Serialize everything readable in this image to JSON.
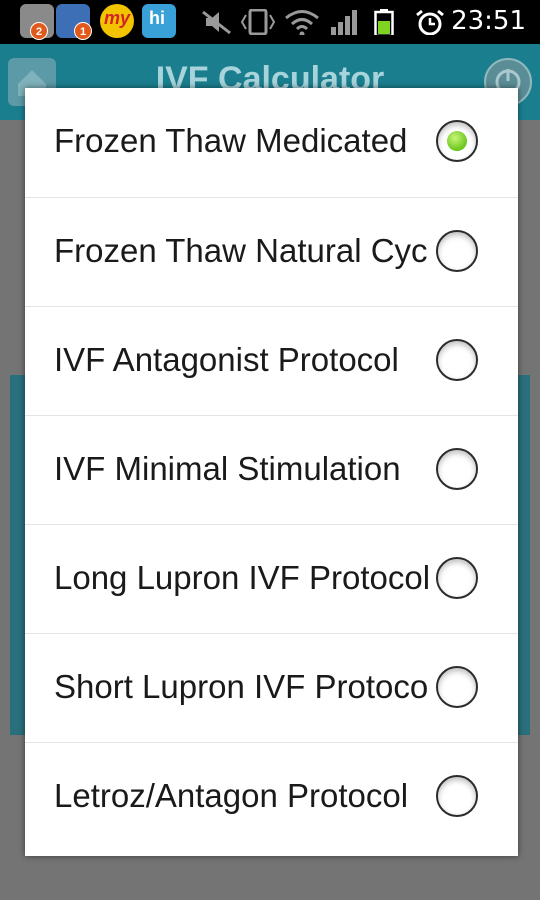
{
  "status_bar": {
    "time": "23:51",
    "badges": [
      "2",
      "1"
    ],
    "app_icon_label": "my",
    "hi_icon_label": "hi"
  },
  "app": {
    "title": "IVF Calculator",
    "accent_color": "#1b7e8e"
  },
  "dialog": {
    "options": [
      {
        "label": "Frozen Thaw Medicated",
        "selected": true
      },
      {
        "label": "Frozen Thaw Natural Cycle",
        "selected": false
      },
      {
        "label": "IVF Antagonist Protocol",
        "selected": false
      },
      {
        "label": "IVF Minimal Stimulation",
        "selected": false
      },
      {
        "label": "Long Lupron IVF Protocol",
        "selected": false
      },
      {
        "label": "Short Lupron IVF Protocol",
        "selected": false
      },
      {
        "label": "Letroz/Antagon Protocol",
        "selected": false
      }
    ],
    "selected_color": "#69c61b"
  }
}
